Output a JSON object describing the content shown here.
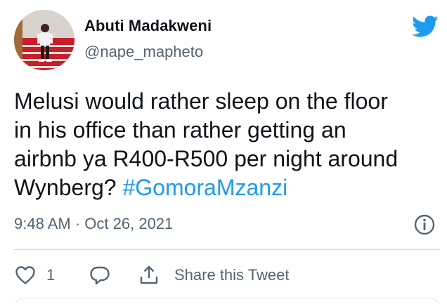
{
  "author": {
    "display_name": "Abuti Madakweni",
    "handle": "@nape_mapheto",
    "avatar_icon": "avatar-photo"
  },
  "brand": {
    "icon": "twitter-bird-icon",
    "color": "#1d9bf0"
  },
  "tweet": {
    "text": "Melusi would rather sleep on the floor\nin his office than rather getting an\nairbnb ya R400-R500 per night around\nWynberg? ",
    "hashtag": "#GomoraMzanzi",
    "time": "9:48 AM",
    "separator": "·",
    "date": "Oct 26, 2021"
  },
  "actions": {
    "like_count": "1",
    "share_label": "Share this Tweet",
    "icons": [
      "heart-icon",
      "reply-icon",
      "share-icon",
      "info-icon"
    ]
  }
}
